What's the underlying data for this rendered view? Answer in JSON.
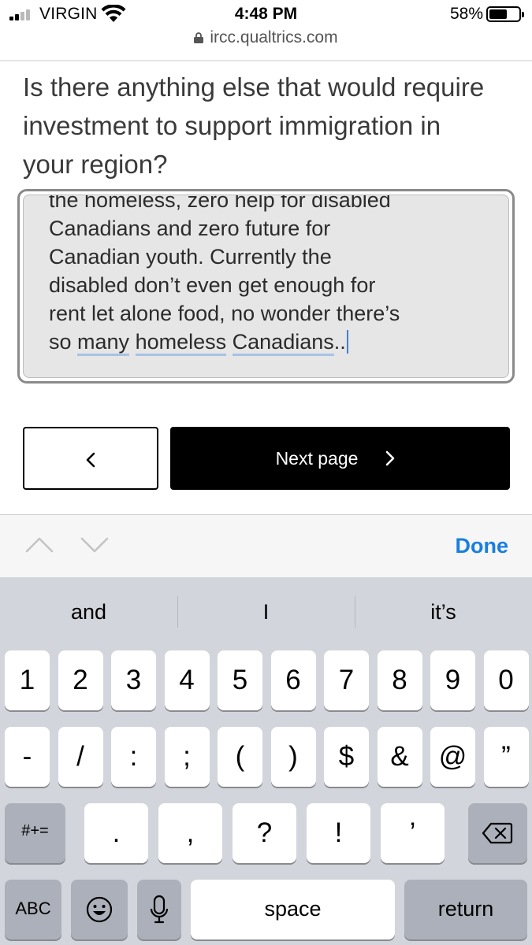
{
  "status_bar": {
    "carrier": "VIRGIN",
    "time": "4:48 PM",
    "battery_percent": "58%",
    "battery_level": 0.58,
    "icons": [
      "signal-icon",
      "wifi-icon",
      "battery-icon"
    ]
  },
  "browser": {
    "url": "ircc.qualtrics.com",
    "url_icon": "lock-icon"
  },
  "survey": {
    "question": "Is there anything else that would require investment to support immigration in your region?",
    "answer": {
      "line_1": "the homeless, zero help for disabled",
      "line_2": "Canadians and zero future for",
      "line_3": "Canadian youth. Currently the",
      "line_4": "disabled don’t even get enough for",
      "line_5": "rent let alone food, no wonder there’s",
      "line_6_start": "so ",
      "word_many": "many",
      "word_homeless": "homeless",
      "word_canadians": "Canadians",
      "line_6_end": ".."
    },
    "prev_icon": "chevron-left-icon",
    "next_label": "Next page",
    "next_icon": "chevron-right-icon"
  },
  "keyboard_accessory": {
    "done_label": "Done",
    "icons": [
      "chevron-up-icon",
      "chevron-down-icon"
    ]
  },
  "keyboard": {
    "suggestions": [
      "and",
      "I",
      "it’s"
    ],
    "row1": [
      "1",
      "2",
      "3",
      "4",
      "5",
      "6",
      "7",
      "8",
      "9",
      "0"
    ],
    "row2": [
      "-",
      "/",
      ":",
      ";",
      "(",
      ")",
      "$",
      "&",
      "@",
      "”"
    ],
    "row3_switch": "#+=",
    "row3": [
      ".",
      ",",
      "?",
      "!",
      "’"
    ],
    "delete_icon": "backspace-icon",
    "abc_label": "ABC",
    "emoji_icon": "emoji-icon",
    "mic_icon": "microphone-icon",
    "space_label": "space",
    "return_label": "return"
  },
  "colors": {
    "accent": "#1a7ee0",
    "keyboard_bg": "#d2d5db",
    "dark_key": "#abb0ba",
    "field_bg": "#e6e6e6"
  }
}
